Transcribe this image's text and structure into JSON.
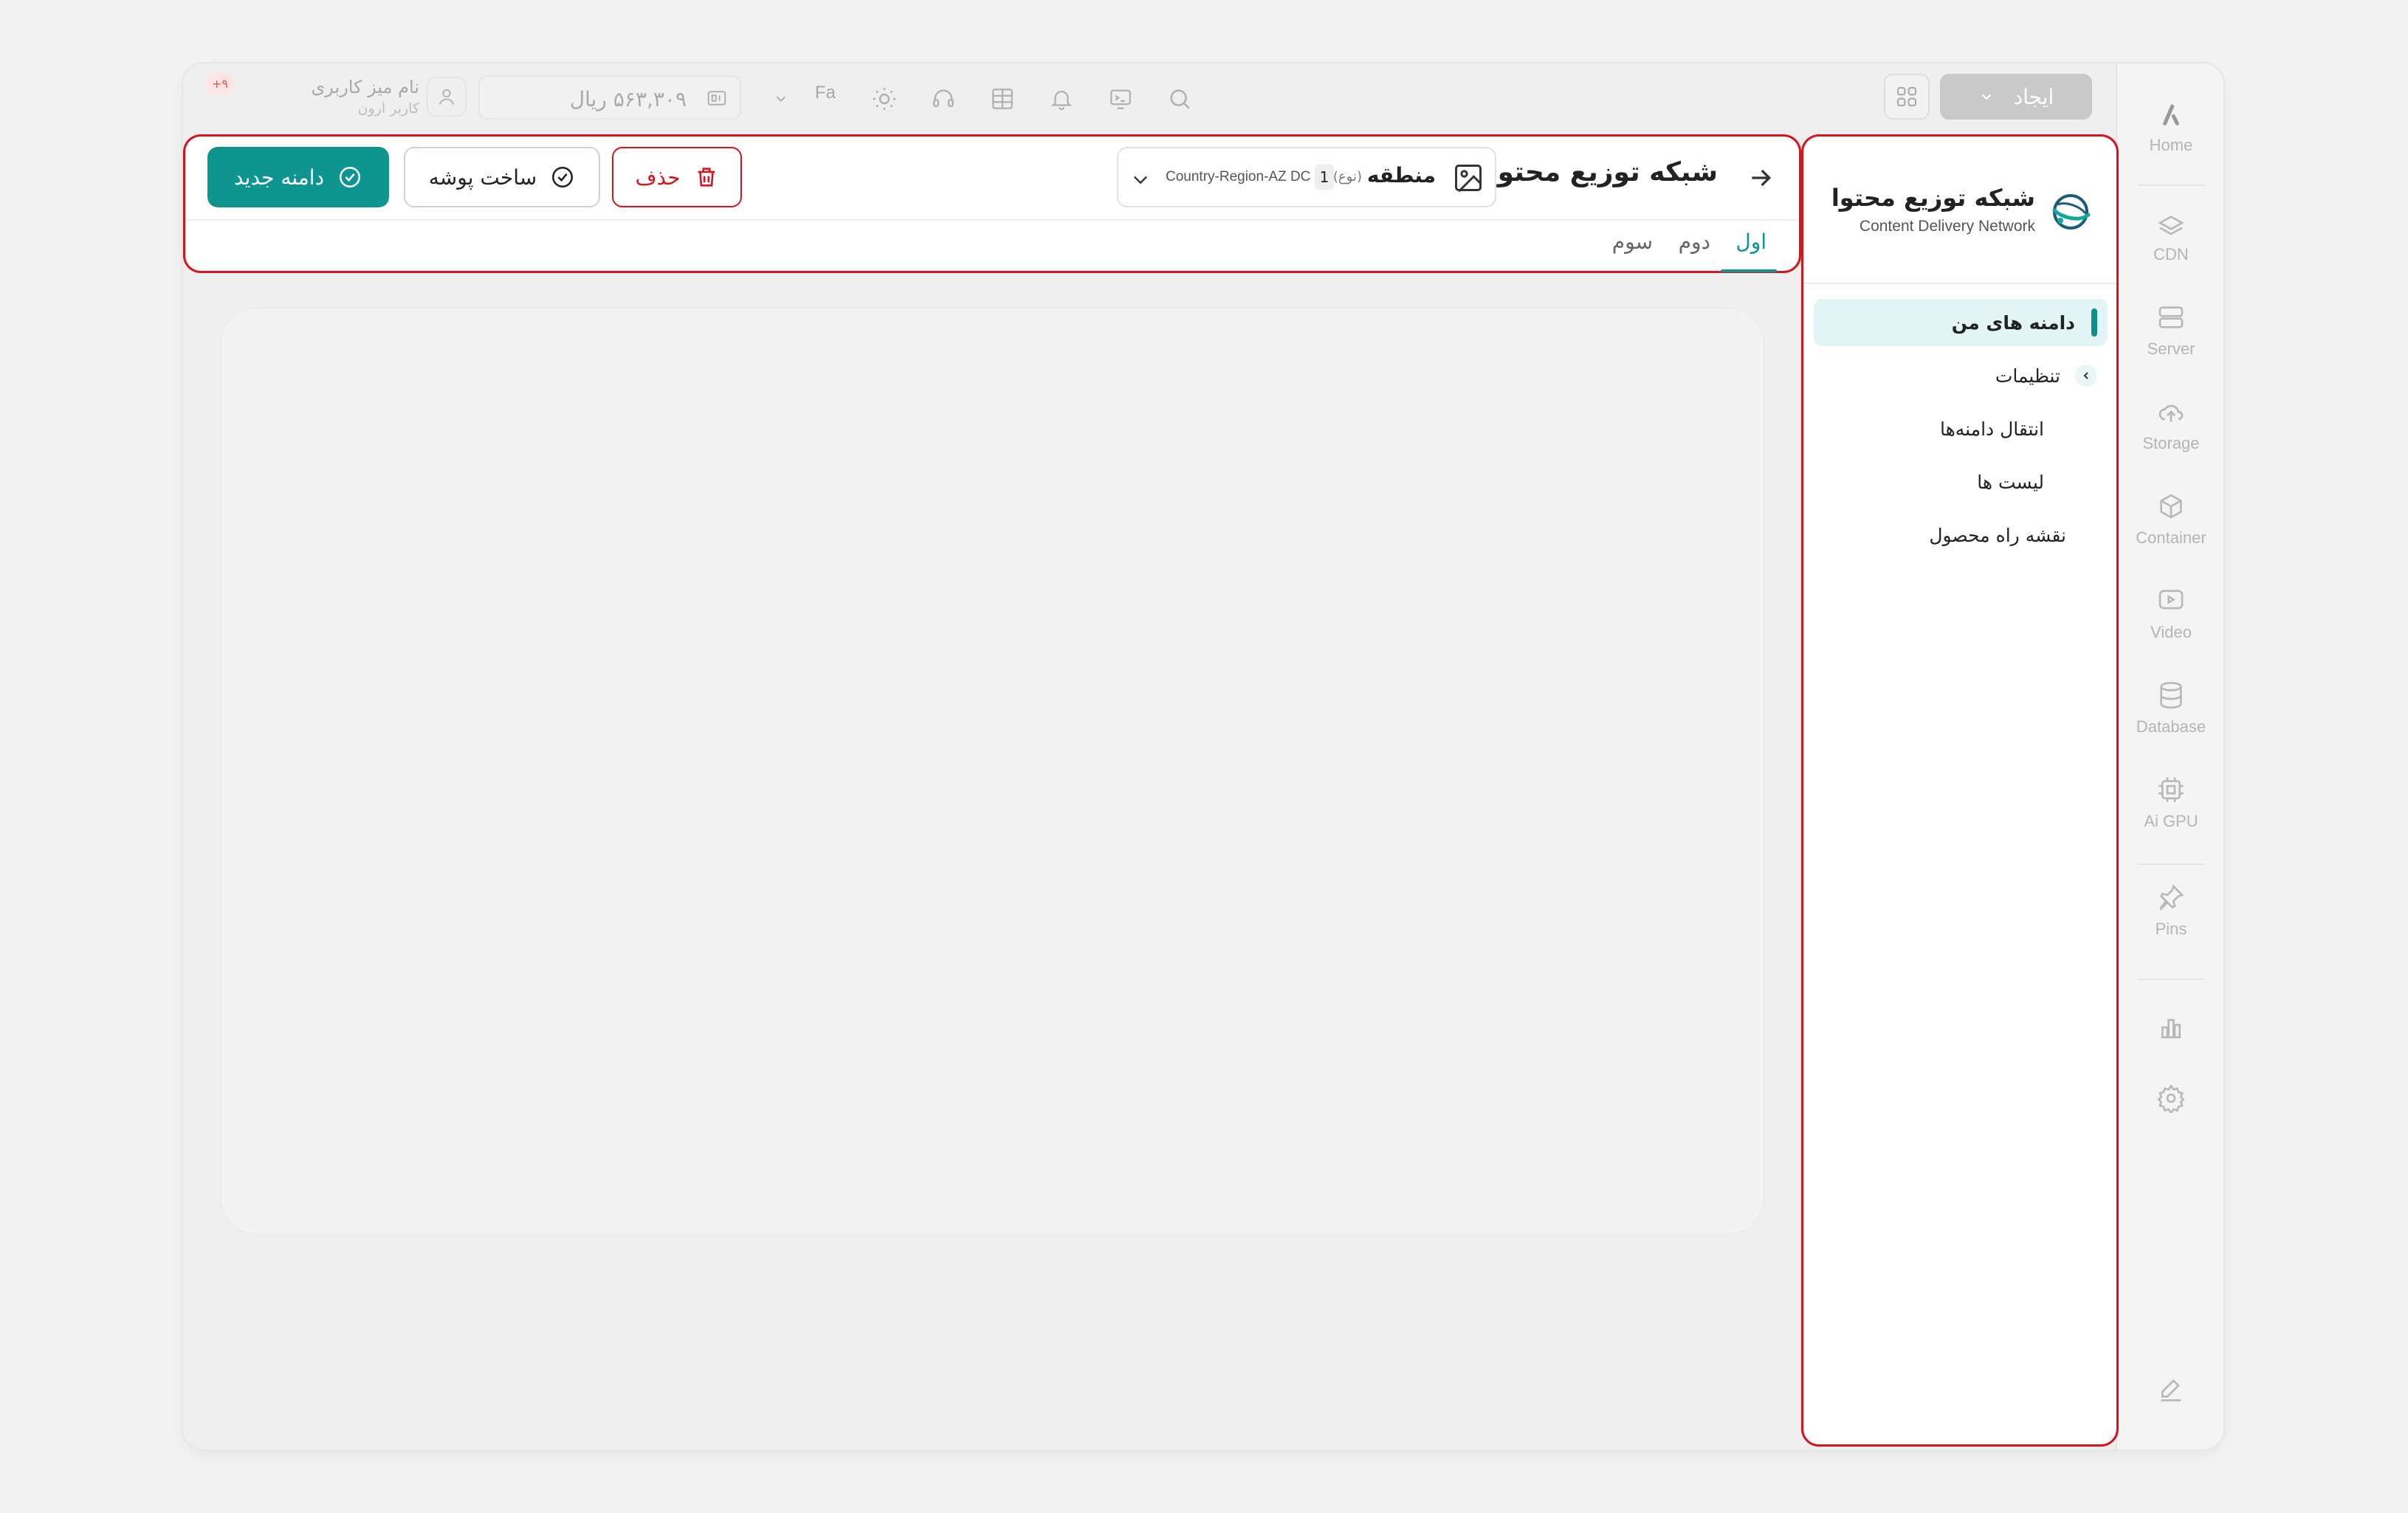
{
  "topbar": {
    "create_label": "ایجاد",
    "language": "Fa",
    "balance_amount": "۵۶۳,۳۰۹",
    "balance_currency": "ریال",
    "user_name": "نام میز کاربری",
    "user_role": "کاربر ارون",
    "notifications_count": "+۹"
  },
  "rail": {
    "items": [
      {
        "label": "Home",
        "icon": "brand-logo-icon"
      },
      {
        "label": "CDN",
        "icon": "cdn-icon"
      },
      {
        "label": "Server",
        "icon": "server-icon"
      },
      {
        "label": "Storage",
        "icon": "cloud-icon"
      },
      {
        "label": "Container",
        "icon": "cube-icon"
      },
      {
        "label": "Video",
        "icon": "video-icon"
      },
      {
        "label": "Database",
        "icon": "database-icon"
      },
      {
        "label": "Ai GPU",
        "icon": "chip-icon"
      },
      {
        "label": "Pins",
        "icon": "pin-icon"
      }
    ]
  },
  "service": {
    "title": "شبکه توزیع محتوا",
    "subtitle": "Content Delivery Network",
    "menu": [
      {
        "label": "دامنه های من",
        "active": true
      },
      {
        "label": "تنظیمات"
      },
      {
        "label": "انتقال دامنه‌ها"
      },
      {
        "label": "لیست ها"
      },
      {
        "label": "نقشه راه محصول"
      }
    ]
  },
  "header": {
    "title": "شبکه توزیع محتوا",
    "region_label": "منطقه",
    "region_type": "(نوع)",
    "region_count": "1",
    "region_value": "Country-Region-AZ DC",
    "delete_label": "حذف",
    "create_folder_label": "ساخت پوشه",
    "new_domain_label": "دامنه جدید",
    "tabs": [
      "اول",
      "دوم",
      "سوم"
    ]
  },
  "colors": {
    "accent": "#0e9590",
    "danger": "#d6141c",
    "active_menu_bg": "#e3f4f4"
  }
}
